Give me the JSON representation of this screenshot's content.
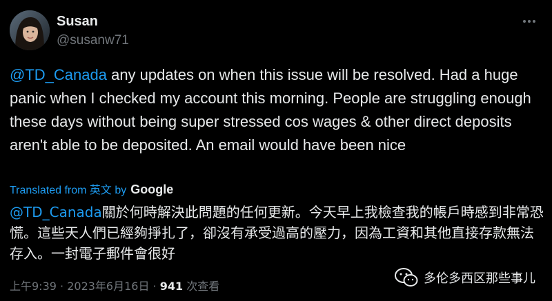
{
  "user": {
    "display_name": "Susan",
    "handle": "@susanw71"
  },
  "tweet": {
    "mention": "@TD_Canada",
    "body": " any updates on when this issue will be resolved. Had a huge panic when I checked my account this morning.  People are struggling enough these days without being super stressed cos wages & other direct deposits aren't able to be deposited.  An email would have been nice"
  },
  "translation": {
    "label": "Translated from 英文 by",
    "provider": "Google",
    "mention": "@TD_Canada",
    "body": "關於何時解決此問題的任何更新。今天早上我檢查我的帳戶時感到非常恐慌。這些天人們已經夠掙扎了，卻沒有承受過高的壓力，因為工資和其他直接存款無法存入。一封電子郵件會很好"
  },
  "meta": {
    "time": "上午9:39",
    "separator": " · ",
    "date": "2023年6月16日",
    "separator2": " · ",
    "views_count": "941",
    "views_label": " 次查看"
  },
  "watermark": {
    "text": "多伦多西区那些事儿"
  }
}
